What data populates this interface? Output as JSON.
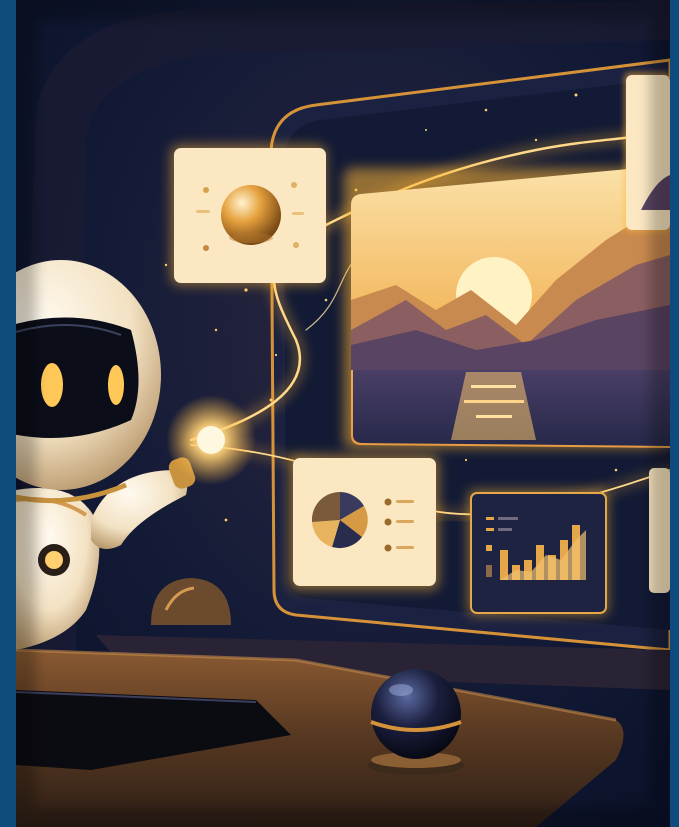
{
  "colors": {
    "border_blue": "#0f4c7d",
    "room_dark": "#0c1630",
    "glow_gold": "#ffb636",
    "panel_cream": "#fbe7c2",
    "desk_brown": "#5b3a22"
  },
  "scene": {
    "subject": "robot",
    "panels": [
      "sphere-panel",
      "landscape-panel",
      "pie-chart-panel",
      "bar-chart-panel"
    ]
  }
}
